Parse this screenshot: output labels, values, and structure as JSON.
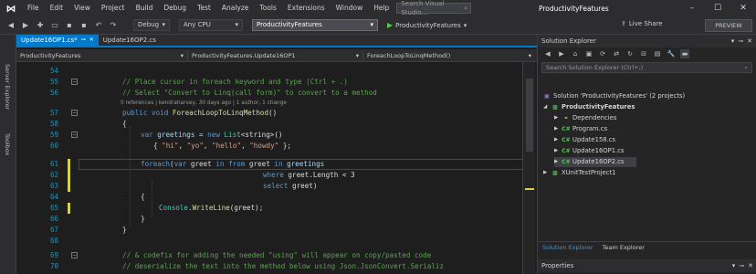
{
  "menu": {
    "items": [
      "File",
      "Edit",
      "View",
      "Project",
      "Build",
      "Debug",
      "Test",
      "Analyze",
      "Tools",
      "Extensions",
      "Window",
      "Help"
    ],
    "search_placeholder": "Search Visual Studio..."
  },
  "title": "ProductivityFeatures",
  "toolbar": {
    "config": "Debug",
    "platform": "Any CPU",
    "startup_project": "ProductivityFeatures",
    "run_label": "ProductivityFeatures",
    "live_share": "Live Share",
    "preview_badge": "PREVIEW"
  },
  "left_strip": {
    "server_explorer": "Server Explorer",
    "toolbox": "Toolbox"
  },
  "tabs": [
    {
      "label": "Update16OP1.cs*",
      "active": true
    },
    {
      "label": "Update16OP2.cs",
      "active": false
    }
  ],
  "navbar": {
    "project": "ProductivityFeatures",
    "class": "ProductivityFeatures.Update16OP1",
    "member": "ForeachLoopToLinqMethod()"
  },
  "editor": {
    "line_numbers": [
      "54",
      "55",
      "56",
      "57",
      "58",
      "59",
      "60",
      "61",
      "62",
      "63",
      "64",
      "65",
      "66",
      "67",
      "68",
      "69",
      "70"
    ],
    "codelens": "0 references | kendraharvey, 30 days ago | 1 author, 1 change",
    "code": {
      "l55": "// Place cursor in foreach keyword and type (Ctrl + .)",
      "l56": "// Select \"Convert to Linq(call form)\" to convert to a method",
      "l57_kw1": "public",
      "l57_kw2": "void",
      "l57_method": "ForeachLoopToLinqMethod",
      "l57_rest": "()",
      "l58": "{",
      "l59_kw": "var",
      "l59_var": "greetings",
      "l59_eq": " = ",
      "l59_new": "new",
      "l59_type": "List",
      "l59_gen": "<string>()",
      "l60_open": "{ ",
      "l60_s1": "\"hi\"",
      "l60_c1": ", ",
      "l60_s2": "\"yo\"",
      "l60_c2": ", ",
      "l60_s3": "\"hello\"",
      "l60_c3": ", ",
      "l60_s4": "\"howdy\"",
      "l60_close": " };",
      "l61_kw": "foreach",
      "l61_p1": "(",
      "l61_var": "var",
      "l61_greet": " greet ",
      "l61_in": "in",
      "l61_from": "from",
      "l61_rest": " greet ",
      "l61_in2": "in",
      "l61_coll": " greetings",
      "l62_where": "where",
      "l62_rest": " greet.Length < 3",
      "l63_select": "select",
      "l63_rest": " greet)",
      "l64": "{",
      "l65_type": "Console",
      "l65_dot": ".",
      "l65_method": "WriteLine",
      "l65_rest": "(greet);",
      "l66": "}",
      "l67": "}",
      "l69": "// & codefix for adding the needed \"using\" will appear on copy/pasted code",
      "l70": "// deserialize the text into the method below using Json.JsonConvert.Serializ"
    }
  },
  "solution_explorer": {
    "title": "Solution Explorer",
    "search_placeholder": "Search Solution Explorer (Ctrl+;)",
    "tree": [
      {
        "label": "Solution 'ProductivityFeatures' (2 projects)",
        "indent": 0,
        "icon": "solution-icon",
        "expand": ""
      },
      {
        "label": "ProductivityFeatures",
        "indent": 1,
        "icon": "project-icon",
        "expand": "▲",
        "bold": true
      },
      {
        "label": "Dependencies",
        "indent": 2,
        "icon": "dependencies-icon",
        "expand": "▶"
      },
      {
        "label": "Program.cs",
        "indent": 2,
        "icon": "cs-file-icon",
        "expand": "▶"
      },
      {
        "label": "Update158.cs",
        "indent": 2,
        "icon": "cs-file-icon",
        "expand": "▶"
      },
      {
        "label": "Update16OP1.cs",
        "indent": 2,
        "icon": "cs-file-icon",
        "expand": "▶"
      },
      {
        "label": "Update16OP2.cs",
        "indent": 2,
        "icon": "cs-file-icon",
        "expand": "▶",
        "selected": true
      },
      {
        "label": "XUnitTestProject1",
        "indent": 1,
        "icon": "test-project-icon",
        "expand": "▶"
      }
    ],
    "tabs": [
      "Solution Explorer",
      "Team Explorer"
    ],
    "properties_title": "Properties"
  }
}
